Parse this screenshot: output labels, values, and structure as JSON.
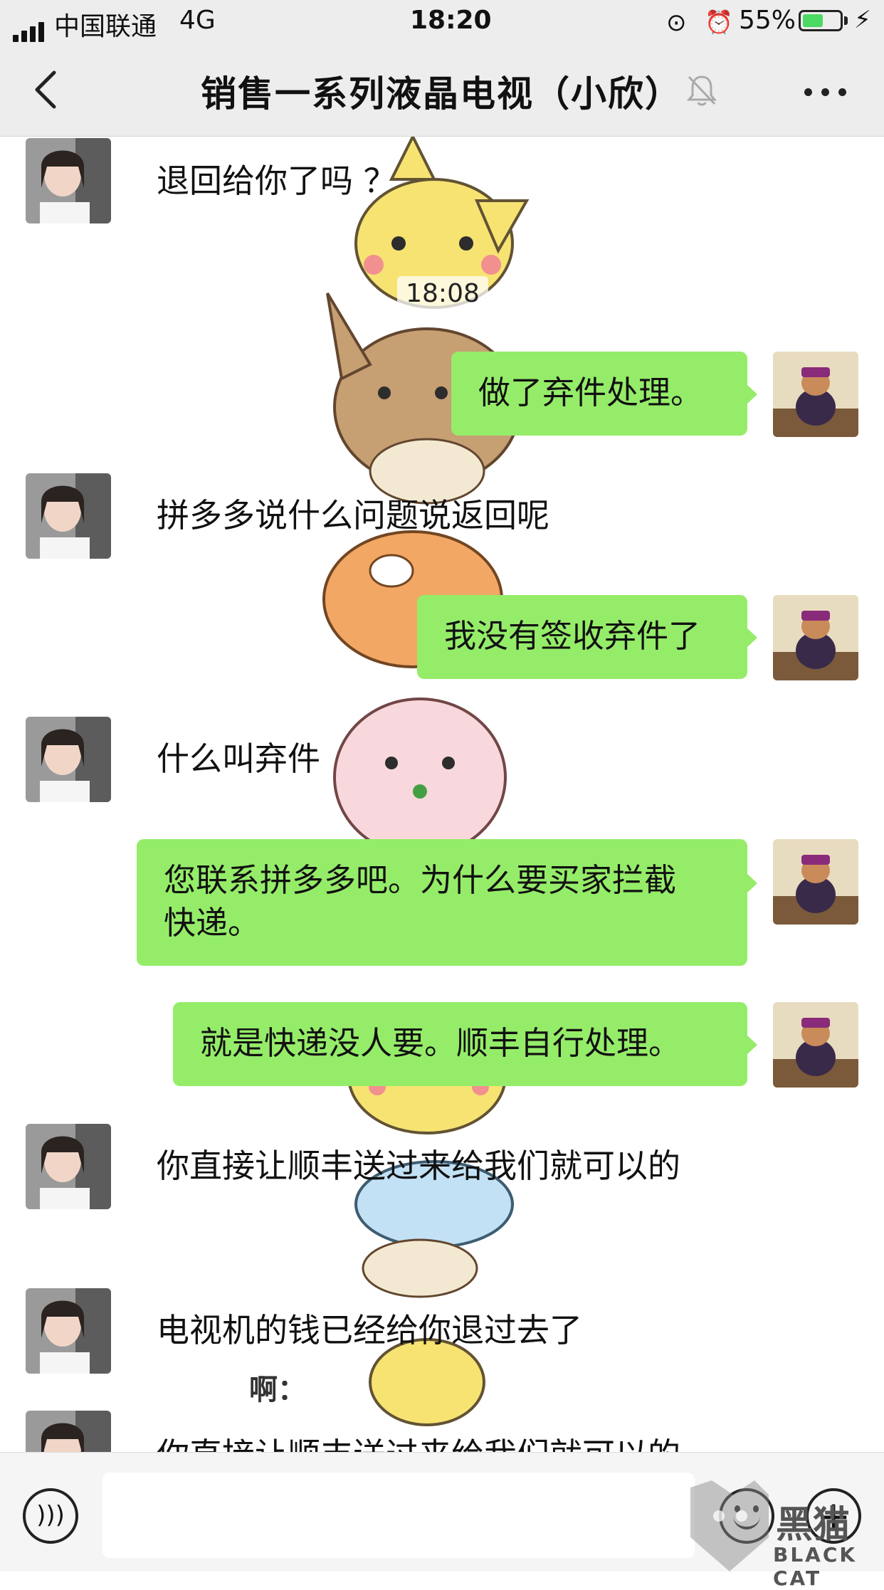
{
  "status_bar": {
    "carrier": "中国联通",
    "network": "4G",
    "time": "18:20",
    "battery": "55%",
    "battery_level": 0.55
  },
  "header": {
    "title": "销售一系列液晶电视（小欣）"
  },
  "messages": [
    {
      "side": "left",
      "text": "退回给你了吗 ？"
    },
    {
      "type": "timestamp",
      "text": "18:08"
    },
    {
      "side": "right",
      "text": "做了弃件处理。"
    },
    {
      "side": "left",
      "text": "拼多多说什么问题说返回呢"
    },
    {
      "side": "right",
      "text": "我没有签收弃件了"
    },
    {
      "side": "left",
      "text": "什么叫弃件"
    },
    {
      "side": "right",
      "line1": "您联系拼多多吧。为什么要买家拦截",
      "line2": "快递。"
    },
    {
      "side": "right",
      "text": "就是快递没人要。顺丰自行处理。"
    },
    {
      "side": "left",
      "text": "你直接让顺丰送过来给我们就可以的"
    },
    {
      "side": "left",
      "text": "电视机的钱已经给你退过去了"
    },
    {
      "side": "left",
      "text": "你直接让顺丰送过来给我们就可以的"
    }
  ],
  "sticker_text": "啊：",
  "watermark": {
    "cn": "黑猫",
    "en": "BLACK CAT"
  },
  "colors": {
    "bubble_green": "#95ec69",
    "bar_bg": "#ededed"
  }
}
